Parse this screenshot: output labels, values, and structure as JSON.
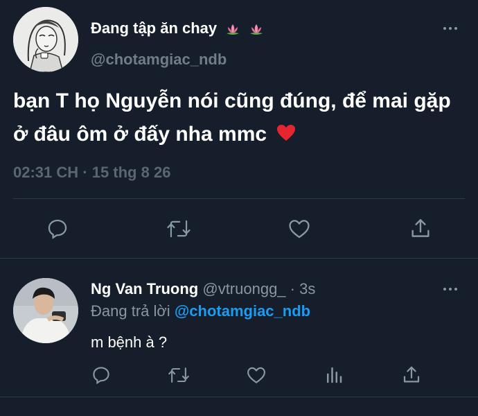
{
  "tweet": {
    "author_name": "Đang tập ăn chay",
    "author_handle": "@chotamgiac_ndb",
    "text": "bạn T họ Nguyễn nói cũng đúng, để mai gặp ở đâu ôm ở đấy nha mmc",
    "timestamp": "02:31 CH · 15 thg 8 26",
    "icons": {
      "emojis": [
        "lotus-emoji",
        "lotus-emoji",
        "red-heart-emoji"
      ],
      "actions": [
        "reply-icon",
        "retweet-icon",
        "like-icon",
        "share-icon"
      ],
      "more": "more-icon"
    }
  },
  "reply": {
    "author_name": "Ng Van Truong",
    "author_handle": "@vtruongg_",
    "time_ago": "· 3s",
    "replying_to_label": "Đang trả lời",
    "replying_to_handle": "@chotamgiac_ndb",
    "text": "m bệnh à ?",
    "icons": {
      "actions": [
        "reply-icon",
        "retweet-icon",
        "like-icon",
        "analytics-icon",
        "share-icon"
      ],
      "more": "more-icon"
    }
  },
  "colors": {
    "background": "#151e2a",
    "text_primary": "#ffffff",
    "text_secondary": "#8b96a2",
    "link": "#1d9bf0",
    "divider": "#2f3a46"
  }
}
